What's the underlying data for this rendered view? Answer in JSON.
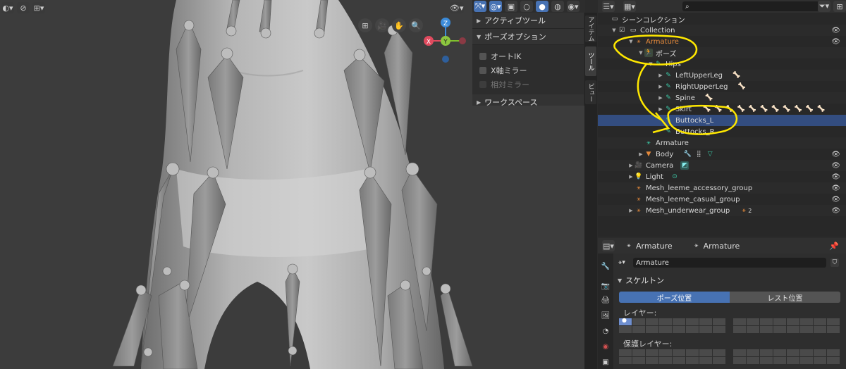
{
  "viewport": {
    "header_right_icons": [
      "view-eye-icon",
      "gizmo-icon",
      "overlay-icon",
      "xray-icon",
      "solid-shading",
      "material-shading",
      "rendered-shading"
    ],
    "nav_icons": [
      "grid-icon",
      "camera-icon",
      "hand-icon",
      "zoom-icon"
    ],
    "gizmo": {
      "z": "Z",
      "x": "X",
      "y": "Y"
    }
  },
  "npanel": {
    "sections": [
      {
        "label": "アクティブツール",
        "expanded": false
      },
      {
        "label": "ポーズオプション",
        "expanded": true
      },
      {
        "label": "ワークスペース",
        "expanded": false
      }
    ],
    "options": [
      {
        "label": "オートIK",
        "disabled": false
      },
      {
        "label": "X軸ミラー",
        "disabled": false
      },
      {
        "label": "相対ミラー",
        "disabled": true
      }
    ]
  },
  "vtabs": [
    {
      "label": "アイテム",
      "active": false
    },
    {
      "label": "ツール",
      "active": true
    },
    {
      "label": "ビュー",
      "active": false
    }
  ],
  "outliner": {
    "search_placeholder": "",
    "rows": [
      {
        "label": "シーンコレクション",
        "indent": 0
      },
      {
        "label": "Collection",
        "indent": 1
      },
      {
        "label": "Armature",
        "indent": 2
      },
      {
        "label": "ポーズ",
        "indent": 3
      },
      {
        "label": "Hips",
        "indent": 4
      },
      {
        "label": "LeftUpperLeg",
        "indent": 5
      },
      {
        "label": "RightUpperLeg",
        "indent": 5
      },
      {
        "label": "Spine",
        "indent": 5
      },
      {
        "label": "Skirt",
        "indent": 5
      },
      {
        "label": "Buttocks_L",
        "indent": 5
      },
      {
        "label": "Buttocks_R",
        "indent": 5
      },
      {
        "label": "Armature",
        "indent": 3
      },
      {
        "label": "Body",
        "indent": 3
      },
      {
        "label": "Camera",
        "indent": 2
      },
      {
        "label": "Light",
        "indent": 2
      },
      {
        "label": "Mesh_leeme_accessory_group",
        "indent": 2
      },
      {
        "label": "Mesh_leeme_casual_group",
        "indent": 2
      },
      {
        "label": "Mesh_underwear_group",
        "indent": 2
      }
    ],
    "mesh_underwear_badge": "2"
  },
  "properties": {
    "breadcrumb_object": "Armature",
    "breadcrumb_data": "Armature",
    "datablock_name": "Armature",
    "section_skeleton": "スケルトン",
    "pose_position": "ポーズ位置",
    "rest_position": "レスト位置",
    "layers_label": "レイヤー:",
    "protected_layers_label": "保護レイヤー:"
  },
  "colors": {
    "accent_blue": "#4772b3",
    "bone_green": "#3cc8a6",
    "object_orange": "#e3893b",
    "annotation_yellow": "#ffe800",
    "selection": "#334d80"
  }
}
